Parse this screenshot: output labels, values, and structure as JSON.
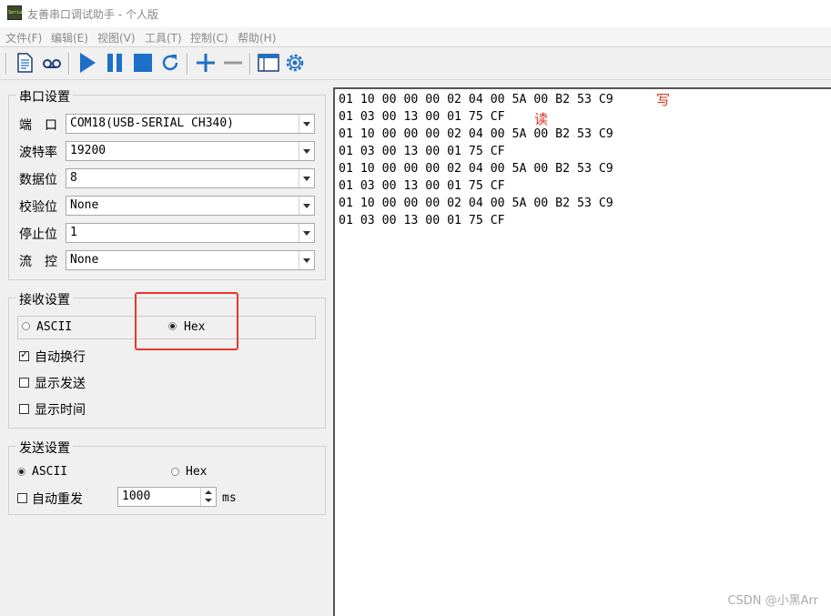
{
  "window": {
    "title": "友善串口调试助手 - 个人版",
    "app_icon_text": "Serial"
  },
  "menu": [
    "文件(F)",
    "编辑(E)",
    "视图(V)",
    "工具(T)",
    "控制(C)",
    "帮助(H)"
  ],
  "toolbar": {
    "icons": [
      "document-icon",
      "record-icon",
      "play-icon",
      "pause-icon",
      "stop-icon",
      "refresh-icon",
      "add-icon",
      "remove-icon",
      "window-icon",
      "gear-icon"
    ],
    "accent_color": "#1e6fc8"
  },
  "serial": {
    "title": "串口设置",
    "fields": [
      {
        "label": "端　口",
        "value": "COM18(USB-SERIAL CH340)"
      },
      {
        "label": "波特率",
        "value": "19200"
      },
      {
        "label": "数据位",
        "value": "8"
      },
      {
        "label": "校验位",
        "value": "None"
      },
      {
        "label": "停止位",
        "value": "1"
      },
      {
        "label": "流　控",
        "value": "None"
      }
    ]
  },
  "receive": {
    "title": "接收设置",
    "ascii": "ASCII",
    "hex": "Hex",
    "selected": "Hex",
    "auto_wrap": {
      "label": "自动换行",
      "checked": true
    },
    "show_send": {
      "label": "显示发送",
      "checked": false
    },
    "show_time": {
      "label": "显示时间",
      "checked": false
    }
  },
  "send": {
    "title": "发送设置",
    "ascii": "ASCII",
    "hex": "Hex",
    "selected": "ASCII",
    "auto_resend": {
      "label": "自动重发",
      "checked": false
    },
    "interval": "1000",
    "unit": "ms"
  },
  "log": {
    "lines": [
      "01 10 00 00 00 02 04 00 5A 00 B2 53 C9",
      "01 03 00 13 00 01 75 CF",
      "01 10 00 00 00 02 04 00 5A 00 B2 53 C9",
      "01 03 00 13 00 01 75 CF",
      "01 10 00 00 00 02 04 00 5A 00 B2 53 C9",
      "01 03 00 13 00 01 75 CF",
      "01 10 00 00 00 02 04 00 5A 00 B2 53 C9",
      "01 03 00 13 00 01 75 CF"
    ],
    "annotation_write": "写",
    "annotation_read": "读",
    "annotation_color": "#e0301e"
  },
  "watermark": "CSDN @小黑Arr"
}
